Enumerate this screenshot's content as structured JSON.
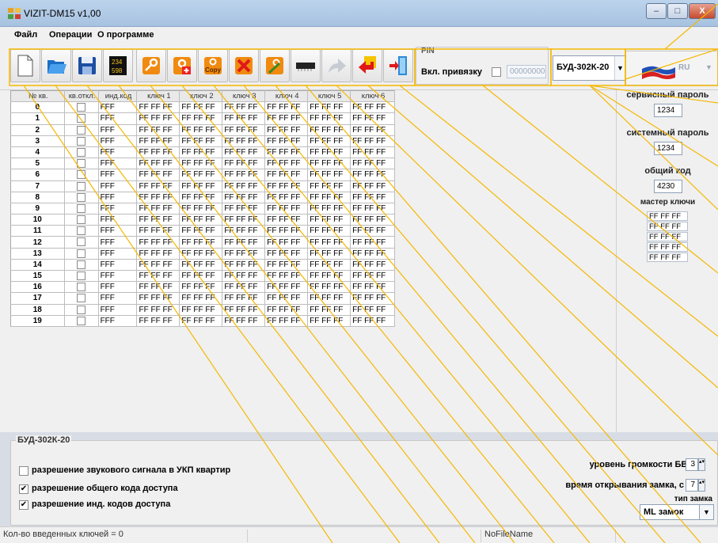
{
  "window": {
    "title": "VIZIT-DM15 v1,00",
    "minimize_label": "–",
    "maximize_label": "□",
    "close_label": "X"
  },
  "menu": {
    "items": [
      {
        "label": "Файл"
      },
      {
        "label": "Операции"
      },
      {
        "label": "О программе"
      }
    ]
  },
  "toolbar": {
    "buttons": [
      {
        "icon": "new-file-icon"
      },
      {
        "icon": "open-folder-icon"
      },
      {
        "icon": "save-icon"
      },
      {
        "icon": "calculator-icon"
      },
      {
        "icon": "key-icon"
      },
      {
        "icon": "add-key-icon"
      },
      {
        "icon": "copy-key-icon",
        "label": "Copy"
      },
      {
        "icon": "delete-key-icon"
      },
      {
        "icon": "edit-key-icon"
      },
      {
        "icon": "chip-icon"
      },
      {
        "icon": "forward-arrow-icon"
      },
      {
        "icon": "return-arrow-icon"
      },
      {
        "icon": "exit-door-icon"
      }
    ],
    "pin": {
      "title": "PIN",
      "label": "Вкл. привязку",
      "value": "00000000"
    },
    "device": {
      "value": "БУД-302К-20",
      "arrow": "▼"
    },
    "language": {
      "value": "RU",
      "arrow": "▼",
      "icon": "russian-flag-icon"
    }
  },
  "table": {
    "columns": [
      "№ кв.",
      "кв.откл.",
      "инд.код",
      "ключ 1",
      "ключ 2",
      "ключ 3",
      "ключ 4",
      "ключ 5",
      "ключ 6"
    ],
    "rows": [
      {
        "num": "0",
        "code": "FFF",
        "k1": "FF FF FF",
        "k2": "FF FF FF",
        "k3": "FF FF FF",
        "k4": "FF FF FF",
        "k5": "FF FF FF",
        "k6": "FF FF FF"
      },
      {
        "num": "1",
        "code": "FFF",
        "k1": "FF FF FF",
        "k2": "FF FF FF",
        "k3": "FF FF FF",
        "k4": "FF FF FF",
        "k5": "FF FF FF",
        "k6": "FF FF FF"
      },
      {
        "num": "2",
        "code": "FFF",
        "k1": "FF FF FF",
        "k2": "FF FF FF",
        "k3": "FF FF FF",
        "k4": "FF FF FF",
        "k5": "FF FF FF",
        "k6": "FF FF FF"
      },
      {
        "num": "3",
        "code": "FFF",
        "k1": "FF FF FF",
        "k2": "FF FF FF",
        "k3": "FF FF FF",
        "k4": "FF FF FF",
        "k5": "FF FF FF",
        "k6": "FF FF FF"
      },
      {
        "num": "4",
        "code": "FFF",
        "k1": "FF FF FF",
        "k2": "FF FF FF",
        "k3": "FF FF FF",
        "k4": "FF FF FF",
        "k5": "FF FF FF",
        "k6": "FF FF FF"
      },
      {
        "num": "5",
        "code": "FFF",
        "k1": "FF FF FF",
        "k2": "FF FF FF",
        "k3": "FF FF FF",
        "k4": "FF FF FF",
        "k5": "FF FF FF",
        "k6": "FF FF FF"
      },
      {
        "num": "6",
        "code": "FFF",
        "k1": "FF FF FF",
        "k2": "FF FF FF",
        "k3": "FF FF FF",
        "k4": "FF FF FF",
        "k5": "FF FF FF",
        "k6": "FF FF FF"
      },
      {
        "num": "7",
        "code": "FFF",
        "k1": "FF FF FF",
        "k2": "FF FF FF",
        "k3": "FF FF FF",
        "k4": "FF FF FF",
        "k5": "FF FF FF",
        "k6": "FF FF FF"
      },
      {
        "num": "8",
        "code": "FFF",
        "k1": "FF FF FF",
        "k2": "FF FF FF",
        "k3": "FF FF FF",
        "k4": "FF FF FF",
        "k5": "FF FF FF",
        "k6": "FF FF FF"
      },
      {
        "num": "9",
        "code": "FFF",
        "k1": "FF FF FF",
        "k2": "FF FF FF",
        "k3": "FF FF FF",
        "k4": "FF FF FF",
        "k5": "FF FF FF",
        "k6": "FF FF FF"
      },
      {
        "num": "10",
        "code": "FFF",
        "k1": "FF FF FF",
        "k2": "FF FF FF",
        "k3": "FF FF FF",
        "k4": "FF FF FF",
        "k5": "FF FF FF",
        "k6": "FF FF FF"
      },
      {
        "num": "11",
        "code": "FFF",
        "k1": "FF FF FF",
        "k2": "FF FF FF",
        "k3": "FF FF FF",
        "k4": "FF FF FF",
        "k5": "FF FF FF",
        "k6": "FF FF FF"
      },
      {
        "num": "12",
        "code": "FFF",
        "k1": "FF FF FF",
        "k2": "FF FF FF",
        "k3": "FF FF FF",
        "k4": "FF FF FF",
        "k5": "FF FF FF",
        "k6": "FF FF FF"
      },
      {
        "num": "13",
        "code": "FFF",
        "k1": "FF FF FF",
        "k2": "FF FF FF",
        "k3": "FF FF FF",
        "k4": "FF FF FF",
        "k5": "FF FF FF",
        "k6": "FF FF FF"
      },
      {
        "num": "14",
        "code": "FFF",
        "k1": "FF FF FF",
        "k2": "FF FF FF",
        "k3": "FF FF FF",
        "k4": "FF FF FF",
        "k5": "FF FF FF",
        "k6": "FF FF FF"
      },
      {
        "num": "15",
        "code": "FFF",
        "k1": "FF FF FF",
        "k2": "FF FF FF",
        "k3": "FF FF FF",
        "k4": "FF FF FF",
        "k5": "FF FF FF",
        "k6": "FF FF FF"
      },
      {
        "num": "16",
        "code": "FFF",
        "k1": "FF FF FF",
        "k2": "FF FF FF",
        "k3": "FF FF FF",
        "k4": "FF FF FF",
        "k5": "FF FF FF",
        "k6": "FF FF FF"
      },
      {
        "num": "17",
        "code": "FFF",
        "k1": "FF FF FF",
        "k2": "FF FF FF",
        "k3": "FF FF FF",
        "k4": "FF FF FF",
        "k5": "FF FF FF",
        "k6": "FF FF FF"
      },
      {
        "num": "18",
        "code": "FFF",
        "k1": "FF FF FF",
        "k2": "FF FF FF",
        "k3": "FF FF FF",
        "k4": "FF FF FF",
        "k5": "FF FF FF",
        "k6": "FF FF FF"
      },
      {
        "num": "19",
        "code": "FFF",
        "k1": "FF FF FF",
        "k2": "FF FF FF",
        "k3": "FF FF FF",
        "k4": "FF FF FF",
        "k5": "FF FF FF",
        "k6": "FF FF FF"
      }
    ]
  },
  "right_panel": {
    "service_password_label": "сервисный пароль",
    "service_password": "1234",
    "system_password_label": "системный пароль",
    "system_password": "1234",
    "common_code_label": "общий код",
    "common_code": "4230",
    "master_keys_label": "мастер ключи",
    "master_keys": [
      "FF FF FF",
      "FF FF FF",
      "FF FF FF",
      "FF FF FF",
      "FF FF FF"
    ]
  },
  "settings": {
    "title": "БУД-302К-20",
    "options": [
      {
        "label": "разрешение звукового сигнала в УКП квартир",
        "checked": false,
        "mark": ""
      },
      {
        "label": "разрешение общего кода доступа",
        "checked": true,
        "mark": "✔"
      },
      {
        "label": "разрешение инд. кодов доступа",
        "checked": true,
        "mark": "✔"
      }
    ],
    "volume_label": "уровень громкости БВД",
    "volume_value": "3",
    "open_time_label": "время открывания замка, с",
    "open_time_value": "7",
    "lock_type_label": "тип замка",
    "lock_type_value": "ML замок",
    "lock_type_arrow": "▼"
  },
  "status_bar": {
    "keys_count": "Кол-во введенных ключей = 0",
    "middle": "",
    "file_name": "NoFileName",
    "right": ""
  },
  "colors": {
    "callout": "#f5b800",
    "titlebar": "#bcd3ec"
  }
}
